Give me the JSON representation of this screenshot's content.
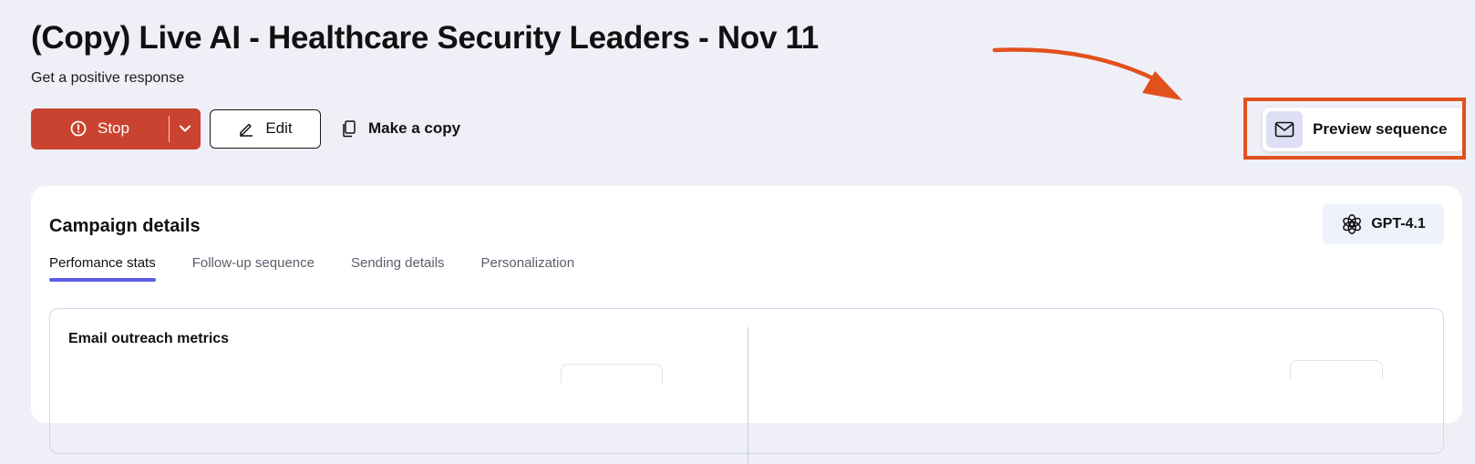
{
  "header": {
    "title": "(Copy) Live AI - Healthcare Security Leaders - Nov 11",
    "subtitle": "Get a positive response"
  },
  "toolbar": {
    "stop_label": "Stop",
    "edit_label": "Edit",
    "copy_label": "Make a copy"
  },
  "preview": {
    "label": "Preview sequence"
  },
  "campaign": {
    "title": "Campaign details",
    "model": "GPT-4.1",
    "tabs": [
      {
        "label": "Perfomance stats",
        "active": true
      },
      {
        "label": "Follow-up sequence",
        "active": false
      },
      {
        "label": "Sending details",
        "active": false
      },
      {
        "label": "Personalization",
        "active": false
      }
    ],
    "metrics_title": "Email outreach metrics"
  },
  "colors": {
    "background": "#efeff7",
    "stop_red": "#c94330",
    "highlight_orange": "#e2501e",
    "tab_indicator": "#5b5ce6",
    "preview_icon_bg": "#dedff4",
    "model_badge_bg": "#eef2fa"
  },
  "icons": {
    "stop": "stop-circle-icon",
    "caret": "chevron-down-icon",
    "edit": "pencil-icon",
    "copy": "copy-icon",
    "preview": "mail-icon",
    "model": "openai-logo-icon"
  }
}
